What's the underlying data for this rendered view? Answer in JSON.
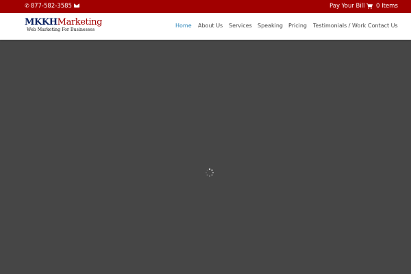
{
  "topbar": {
    "phone_icon": "phone-icon",
    "phone": "877-582-3585",
    "email_icon": "envelope-icon",
    "pay_bill": "Pay Your Bill",
    "cart_icon": "shopping-cart-icon",
    "cart_text": "0 Items",
    "background": "#a10000"
  },
  "logo": {
    "name_part1": "MKKH",
    "name_part2": "Marketing",
    "tagline": "Web Marketing For Businesses"
  },
  "nav": {
    "items": [
      {
        "label": "Home",
        "active": true
      },
      {
        "label": "About Us",
        "active": false
      },
      {
        "label": "Services",
        "active": false
      },
      {
        "label": "Speaking",
        "active": false
      },
      {
        "label": "Pricing",
        "active": false
      },
      {
        "label": "Testimonials / Work",
        "active": false
      },
      {
        "label": "Contact Us",
        "active": false
      }
    ],
    "active_color": "#2a84b8"
  },
  "main": {
    "loader_icon": "loading-spinner-icon",
    "background": "#464646"
  }
}
